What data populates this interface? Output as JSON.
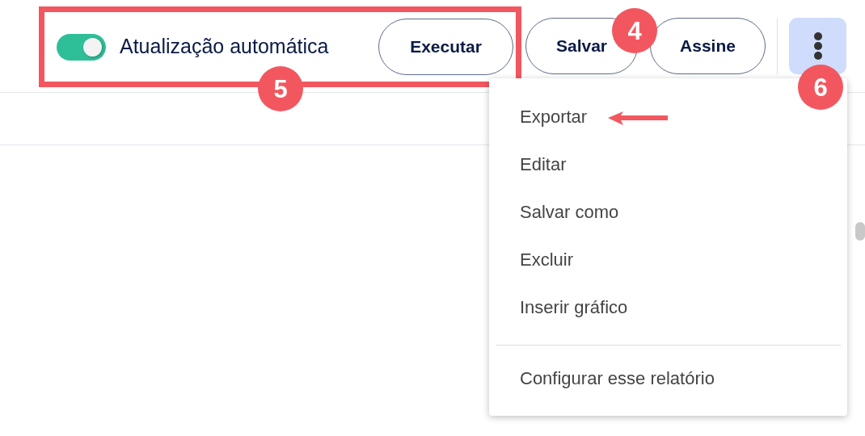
{
  "toolbar": {
    "auto_update": {
      "label": "Atualização automática",
      "on": true
    },
    "buttons": [
      "Executar",
      "Salvar",
      "Assine"
    ],
    "more_menu": {
      "expanded": true
    }
  },
  "menu": {
    "items": [
      {
        "label": "Exportar",
        "kind": "item"
      },
      {
        "label": "Editar",
        "kind": "item"
      },
      {
        "label": "Salvar como",
        "kind": "item"
      },
      {
        "label": "Excluir",
        "kind": "item"
      },
      {
        "label": "Inserir gráfico",
        "kind": "item"
      },
      {
        "kind": "divider"
      },
      {
        "label": "Configurar esse relatório",
        "kind": "item"
      }
    ]
  },
  "callouts": [
    {
      "number": "5"
    },
    {
      "number": "4"
    },
    {
      "number": "6"
    }
  ]
}
